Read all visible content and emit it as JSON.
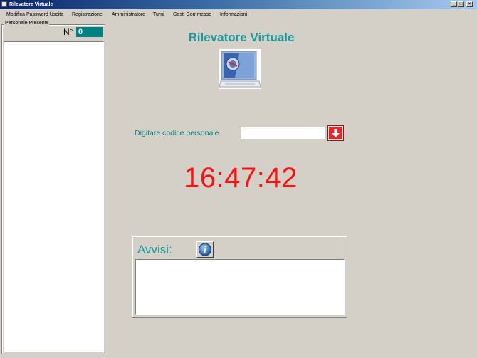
{
  "window": {
    "title": "Rilevatore Virtuale",
    "minimize_glyph": "_",
    "maximize_glyph": "□",
    "close_glyph": "×"
  },
  "menu": [
    {
      "label": "Modifica Password Uscita"
    },
    {
      "label": "Registrazione"
    },
    {
      "label": "Amministratore"
    },
    {
      "label": "Turni"
    },
    {
      "label": "Gest. Commesse"
    },
    {
      "label": "Informazioni"
    }
  ],
  "personale": {
    "group_label": "Personale Presente",
    "count_label": "N°",
    "count_value": "0"
  },
  "main": {
    "title": "Rilevatore Virtuale",
    "code_label": "Digitare codice personale",
    "code_value": "",
    "clock": "16:47:42"
  },
  "avvisi": {
    "label": "Avvisi:"
  },
  "colors": {
    "accent_teal": "#1a9a9a",
    "count_box": "#008080",
    "clock_red": "#ff1010",
    "submit_red": "#e8242c"
  },
  "icons": {
    "logo": "computer-terminal-icon",
    "submit": "arrow-down-icon",
    "info": "info-icon"
  }
}
